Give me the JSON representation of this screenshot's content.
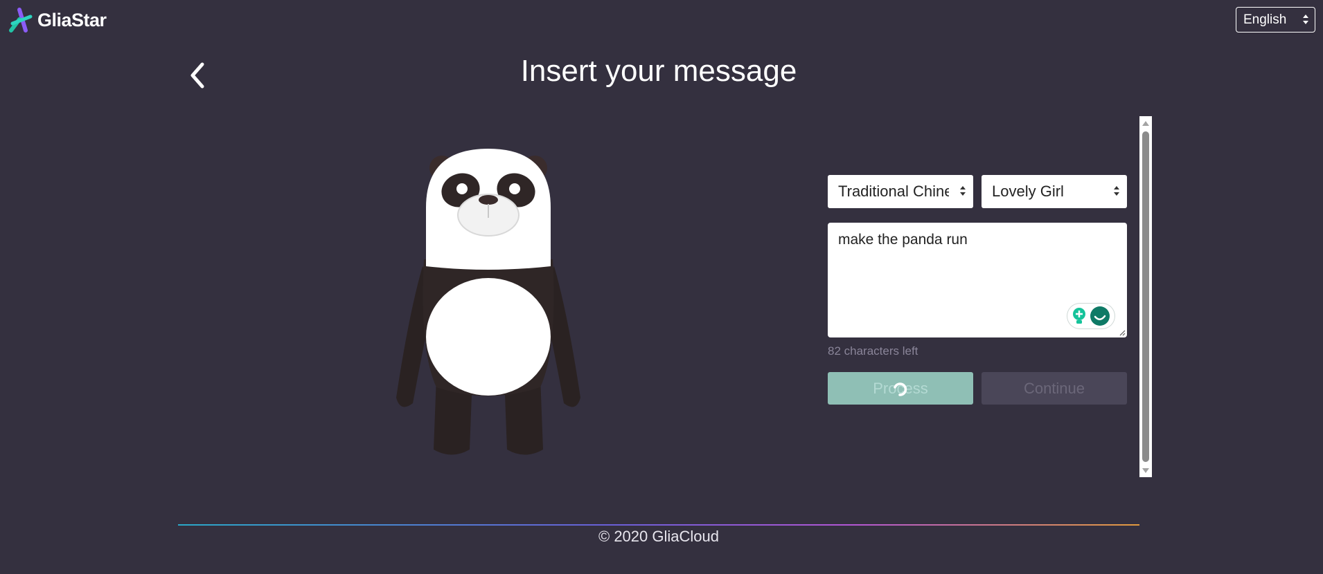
{
  "header": {
    "brand": "GliaStar",
    "language": {
      "selected": "English"
    }
  },
  "page": {
    "title": "Insert your message"
  },
  "form": {
    "voice_language": {
      "selected": "Traditional Chine"
    },
    "voice_style": {
      "selected": "Lovely Girl"
    },
    "message": {
      "value": "make the panda run"
    },
    "chars_left": "82 characters left",
    "process_label": "Process",
    "continue_label": "Continue"
  },
  "footer": {
    "copyright": "© 2020 GliaCloud"
  },
  "colors": {
    "background": "#34303f",
    "process_button": "#8fbfb5",
    "continue_button": "#4a4658",
    "grammarly_green": "#15c39a"
  },
  "icons": [
    "gliastar-logo-icon",
    "chevron-down-icon",
    "back-chevron-icon",
    "grammarly-icon",
    "loading-spinner-icon",
    "scroll-up-icon",
    "scroll-down-icon",
    "resize-handle-icon"
  ]
}
